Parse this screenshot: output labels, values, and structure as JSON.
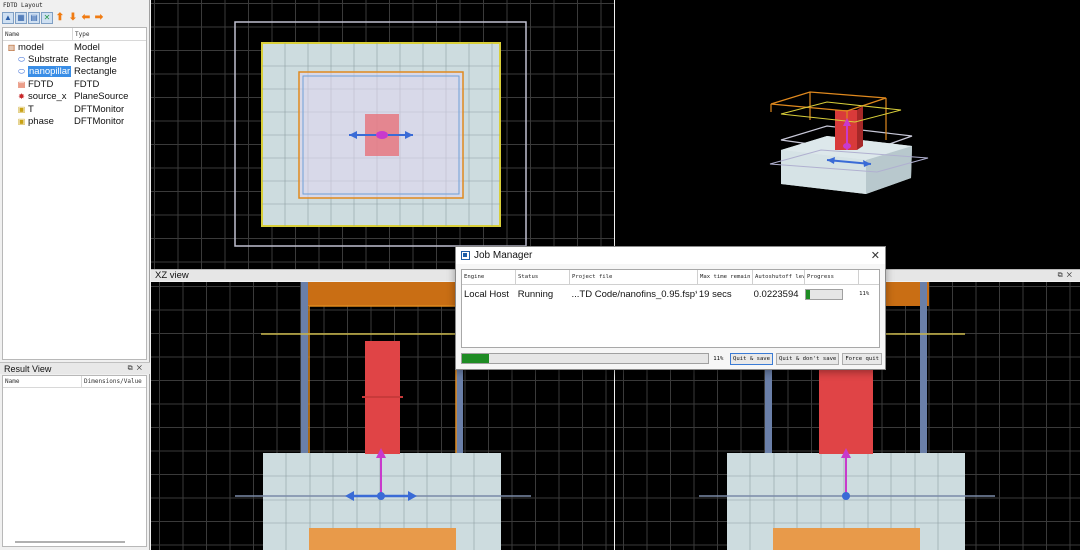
{
  "layout_panel": {
    "title": "FDTD Layout",
    "col_name": "Name",
    "col_type": "Type",
    "toolbar_icons": [
      "select-icon",
      "group-icon",
      "grid-icon",
      "move-icon",
      "arrow-up-icon",
      "arrow-down-icon",
      "arrow-left-icon",
      "arrow-right-icon"
    ],
    "items": [
      {
        "name": "model",
        "type": "Model",
        "icon": "model-icon",
        "indent": 0
      },
      {
        "name": "Substrate",
        "type": "Rectangle",
        "icon": "rectangle-icon",
        "indent": 1
      },
      {
        "name": "nanopillar",
        "type": "Rectangle",
        "icon": "rectangle-icon",
        "indent": 1,
        "selected": true
      },
      {
        "name": "FDTD",
        "type": "FDTD",
        "icon": "fdtd-icon",
        "indent": 1
      },
      {
        "name": "source_x",
        "type": "PlaneSource",
        "icon": "source-icon",
        "indent": 1
      },
      {
        "name": "T",
        "type": "DFTMonitor",
        "icon": "monitor-icon",
        "indent": 1
      },
      {
        "name": "phase",
        "type": "DFTMonitor",
        "icon": "monitor-icon",
        "indent": 1
      }
    ]
  },
  "result_panel": {
    "title": "Result View",
    "col_name": "Name",
    "col_value": "Dimensions/Value"
  },
  "views": {
    "xz_title": "XZ view"
  },
  "job_manager": {
    "title": "Job Manager",
    "columns": [
      "Engine",
      "Status",
      "Project file",
      "Max time remain",
      "Autoshutoff lev",
      "Progress"
    ],
    "rows": [
      {
        "engine": "Local Host",
        "status": "Running",
        "project_file": "...TD Code/nanofins_0.95.fsp*",
        "time_remaining": "19 secs",
        "autoshutoff": "0.0223594",
        "progress_label": "11%",
        "progress": 0.11
      }
    ],
    "overall_progress_label": "11%",
    "overall_progress": 0.11,
    "buttons": {
      "quit_save": "Quit & save",
      "quit_dont_save": "Quit & don't save",
      "force_quit": "Force quit"
    }
  },
  "colors": {
    "accent": "#3a8ee6",
    "progress": "#1e8c24",
    "nanopillar": "#e0464a",
    "substrate": "#cfe0e6",
    "fdtd_boundary": "#e08a1e",
    "source_arrow": "#3a6bd6",
    "monitor": "#c9b74a"
  }
}
